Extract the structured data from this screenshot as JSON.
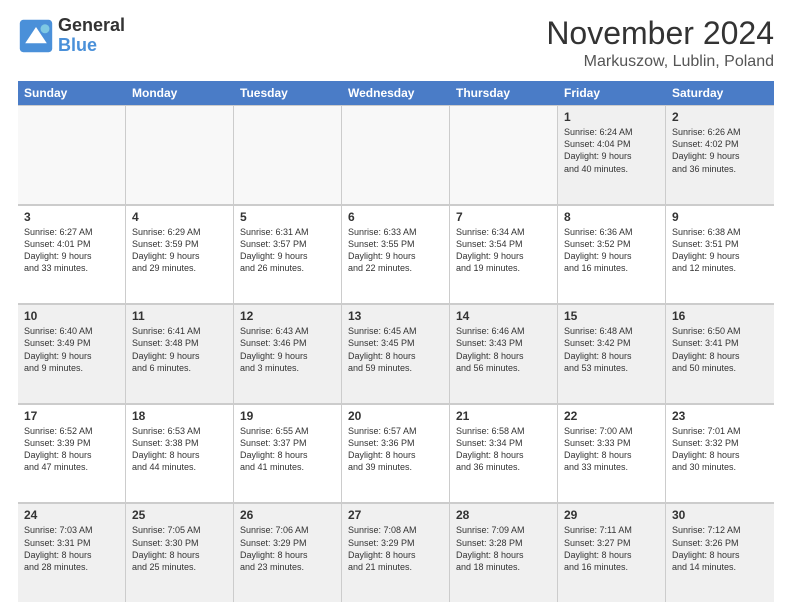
{
  "logo": {
    "text_general": "General",
    "text_blue": "Blue"
  },
  "title": "November 2024",
  "location": "Markuszow, Lublin, Poland",
  "days_of_week": [
    "Sunday",
    "Monday",
    "Tuesday",
    "Wednesday",
    "Thursday",
    "Friday",
    "Saturday"
  ],
  "rows": [
    [
      {
        "day": "",
        "empty": true
      },
      {
        "day": "",
        "empty": true
      },
      {
        "day": "",
        "empty": true
      },
      {
        "day": "",
        "empty": true
      },
      {
        "day": "",
        "empty": true
      },
      {
        "day": "1",
        "lines": [
          "Sunrise: 6:24 AM",
          "Sunset: 4:04 PM",
          "Daylight: 9 hours",
          "and 40 minutes."
        ]
      },
      {
        "day": "2",
        "lines": [
          "Sunrise: 6:26 AM",
          "Sunset: 4:02 PM",
          "Daylight: 9 hours",
          "and 36 minutes."
        ]
      }
    ],
    [
      {
        "day": "3",
        "lines": [
          "Sunrise: 6:27 AM",
          "Sunset: 4:01 PM",
          "Daylight: 9 hours",
          "and 33 minutes."
        ]
      },
      {
        "day": "4",
        "lines": [
          "Sunrise: 6:29 AM",
          "Sunset: 3:59 PM",
          "Daylight: 9 hours",
          "and 29 minutes."
        ]
      },
      {
        "day": "5",
        "lines": [
          "Sunrise: 6:31 AM",
          "Sunset: 3:57 PM",
          "Daylight: 9 hours",
          "and 26 minutes."
        ]
      },
      {
        "day": "6",
        "lines": [
          "Sunrise: 6:33 AM",
          "Sunset: 3:55 PM",
          "Daylight: 9 hours",
          "and 22 minutes."
        ]
      },
      {
        "day": "7",
        "lines": [
          "Sunrise: 6:34 AM",
          "Sunset: 3:54 PM",
          "Daylight: 9 hours",
          "and 19 minutes."
        ]
      },
      {
        "day": "8",
        "lines": [
          "Sunrise: 6:36 AM",
          "Sunset: 3:52 PM",
          "Daylight: 9 hours",
          "and 16 minutes."
        ]
      },
      {
        "day": "9",
        "lines": [
          "Sunrise: 6:38 AM",
          "Sunset: 3:51 PM",
          "Daylight: 9 hours",
          "and 12 minutes."
        ]
      }
    ],
    [
      {
        "day": "10",
        "lines": [
          "Sunrise: 6:40 AM",
          "Sunset: 3:49 PM",
          "Daylight: 9 hours",
          "and 9 minutes."
        ]
      },
      {
        "day": "11",
        "lines": [
          "Sunrise: 6:41 AM",
          "Sunset: 3:48 PM",
          "Daylight: 9 hours",
          "and 6 minutes."
        ]
      },
      {
        "day": "12",
        "lines": [
          "Sunrise: 6:43 AM",
          "Sunset: 3:46 PM",
          "Daylight: 9 hours",
          "and 3 minutes."
        ]
      },
      {
        "day": "13",
        "lines": [
          "Sunrise: 6:45 AM",
          "Sunset: 3:45 PM",
          "Daylight: 8 hours",
          "and 59 minutes."
        ]
      },
      {
        "day": "14",
        "lines": [
          "Sunrise: 6:46 AM",
          "Sunset: 3:43 PM",
          "Daylight: 8 hours",
          "and 56 minutes."
        ]
      },
      {
        "day": "15",
        "lines": [
          "Sunrise: 6:48 AM",
          "Sunset: 3:42 PM",
          "Daylight: 8 hours",
          "and 53 minutes."
        ]
      },
      {
        "day": "16",
        "lines": [
          "Sunrise: 6:50 AM",
          "Sunset: 3:41 PM",
          "Daylight: 8 hours",
          "and 50 minutes."
        ]
      }
    ],
    [
      {
        "day": "17",
        "lines": [
          "Sunrise: 6:52 AM",
          "Sunset: 3:39 PM",
          "Daylight: 8 hours",
          "and 47 minutes."
        ]
      },
      {
        "day": "18",
        "lines": [
          "Sunrise: 6:53 AM",
          "Sunset: 3:38 PM",
          "Daylight: 8 hours",
          "and 44 minutes."
        ]
      },
      {
        "day": "19",
        "lines": [
          "Sunrise: 6:55 AM",
          "Sunset: 3:37 PM",
          "Daylight: 8 hours",
          "and 41 minutes."
        ]
      },
      {
        "day": "20",
        "lines": [
          "Sunrise: 6:57 AM",
          "Sunset: 3:36 PM",
          "Daylight: 8 hours",
          "and 39 minutes."
        ]
      },
      {
        "day": "21",
        "lines": [
          "Sunrise: 6:58 AM",
          "Sunset: 3:34 PM",
          "Daylight: 8 hours",
          "and 36 minutes."
        ]
      },
      {
        "day": "22",
        "lines": [
          "Sunrise: 7:00 AM",
          "Sunset: 3:33 PM",
          "Daylight: 8 hours",
          "and 33 minutes."
        ]
      },
      {
        "day": "23",
        "lines": [
          "Sunrise: 7:01 AM",
          "Sunset: 3:32 PM",
          "Daylight: 8 hours",
          "and 30 minutes."
        ]
      }
    ],
    [
      {
        "day": "24",
        "lines": [
          "Sunrise: 7:03 AM",
          "Sunset: 3:31 PM",
          "Daylight: 8 hours",
          "and 28 minutes."
        ]
      },
      {
        "day": "25",
        "lines": [
          "Sunrise: 7:05 AM",
          "Sunset: 3:30 PM",
          "Daylight: 8 hours",
          "and 25 minutes."
        ]
      },
      {
        "day": "26",
        "lines": [
          "Sunrise: 7:06 AM",
          "Sunset: 3:29 PM",
          "Daylight: 8 hours",
          "and 23 minutes."
        ]
      },
      {
        "day": "27",
        "lines": [
          "Sunrise: 7:08 AM",
          "Sunset: 3:29 PM",
          "Daylight: 8 hours",
          "and 21 minutes."
        ]
      },
      {
        "day": "28",
        "lines": [
          "Sunrise: 7:09 AM",
          "Sunset: 3:28 PM",
          "Daylight: 8 hours",
          "and 18 minutes."
        ]
      },
      {
        "day": "29",
        "lines": [
          "Sunrise: 7:11 AM",
          "Sunset: 3:27 PM",
          "Daylight: 8 hours",
          "and 16 minutes."
        ]
      },
      {
        "day": "30",
        "lines": [
          "Sunrise: 7:12 AM",
          "Sunset: 3:26 PM",
          "Daylight: 8 hours",
          "and 14 minutes."
        ]
      }
    ]
  ]
}
